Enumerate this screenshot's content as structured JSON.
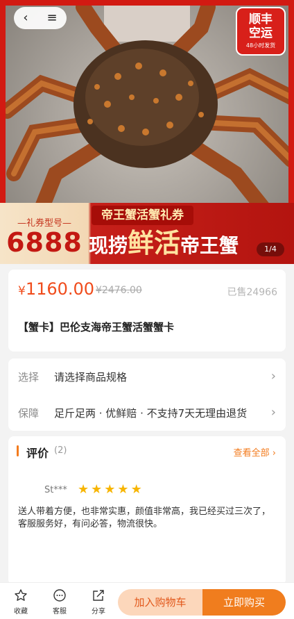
{
  "hero": {
    "nav": {
      "back": "‹",
      "menu": "≡"
    },
    "badge": {
      "line1": "顺丰",
      "line2": "空运",
      "line3": "48小时发货"
    },
    "banner": {
      "kind": "—礼券型号—",
      "number": "6888",
      "ribbon": "帝王蟹活蟹礼券",
      "main_prefix": "现捞",
      "main_highlight": "鲜活",
      "main_suffix": "帝王蟹"
    },
    "pager": "1/4"
  },
  "product": {
    "price_symbol": "¥",
    "price": "1160.00",
    "original_price": "¥2476.00",
    "sold": "已售24966",
    "title": "【蟹卡】巴伦支海帝王蟹活蟹蟹卡"
  },
  "specs": [
    {
      "key": "选择",
      "value": "请选择商品规格"
    },
    {
      "key": "保障",
      "value": "足斤足两 · 优鲜赔 · 不支持7天无理由退货"
    }
  ],
  "reviews": {
    "title": "评价",
    "count": "(2)",
    "view_all": "查看全部",
    "user": "St***",
    "stars": 5,
    "text": "送人带着方便，也非常实惠，颜值非常高，我已经买过三次了，客服服务好，有问必答，物流很快。"
  },
  "bottom_bar": {
    "favorite": "收藏",
    "service": "客服",
    "share": "分享",
    "add_cart": "加入购物车",
    "buy_now": "立即购买"
  },
  "colors": {
    "accent": "#f07d1e",
    "price": "#f04c1c",
    "brand_red": "#d21a12"
  }
}
